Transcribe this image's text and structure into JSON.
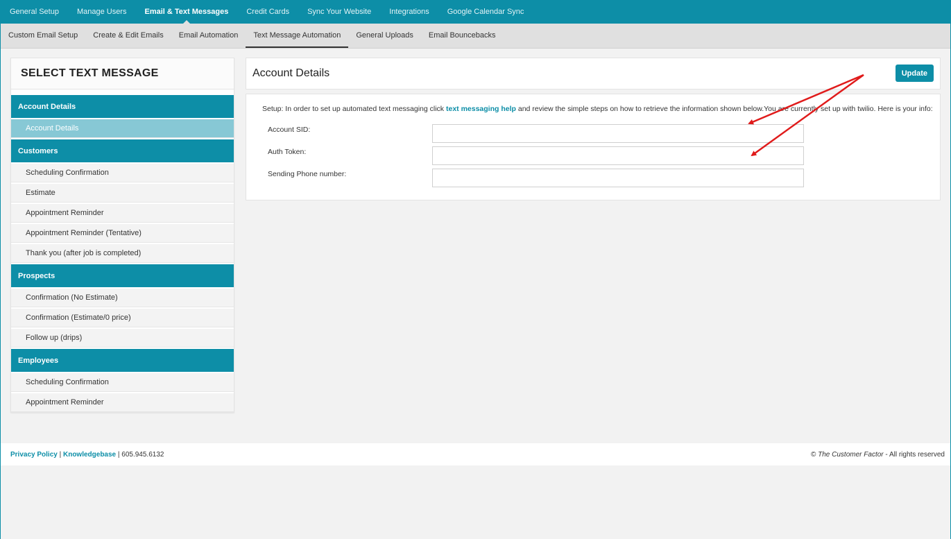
{
  "top_nav": [
    {
      "label": "General Setup"
    },
    {
      "label": "Manage Users"
    },
    {
      "label": "Email & Text Messages",
      "active": true
    },
    {
      "label": "Credit Cards"
    },
    {
      "label": "Sync Your Website"
    },
    {
      "label": "Integrations"
    },
    {
      "label": "Google Calendar Sync"
    }
  ],
  "sub_nav": [
    {
      "label": "Custom Email Setup"
    },
    {
      "label": "Create & Edit Emails"
    },
    {
      "label": "Email Automation"
    },
    {
      "label": "Text Message Automation",
      "active": true
    },
    {
      "label": "General Uploads"
    },
    {
      "label": "Email Bouncebacks"
    }
  ],
  "sidebar": {
    "title": "SELECT TEXT MESSAGE",
    "groups": [
      {
        "label": "Account Details",
        "items": [
          "Account Details"
        ]
      },
      {
        "label": "Customers",
        "items": [
          "Scheduling Confirmation",
          "Estimate",
          "Appointment Reminder",
          "Appointment Reminder (Tentative)",
          "Thank you (after job is completed)"
        ]
      },
      {
        "label": "Prospects",
        "items": [
          "Confirmation (No Estimate)",
          "Confirmation (Estimate/0 price)",
          "Follow up (drips)"
        ]
      },
      {
        "label": "Employees",
        "items": [
          "Scheduling Confirmation",
          "Appointment Reminder"
        ]
      }
    ],
    "selected_item": "Account Details"
  },
  "panel": {
    "title": "Account Details",
    "update_label": "Update",
    "intro_before": "Setup: In order to set up automated text messaging click ",
    "intro_link": "text messaging help",
    "intro_after": " and review the simple steps on how to retrieve the information shown below.You are currently set up with twilio. Here is your info:",
    "fields": [
      {
        "label": "Account SID:",
        "value": ""
      },
      {
        "label": "Auth Token:",
        "value": ""
      },
      {
        "label": "Sending Phone number:",
        "value": ""
      }
    ]
  },
  "footer": {
    "privacy": "Privacy Policy",
    "sep": " | ",
    "kb": "Knowledgebase",
    "phone": " | 605.945.6132",
    "copy_symbol": "© ",
    "company": "The Customer Factor",
    "rights": " - All rights reserved"
  },
  "colors": {
    "brand": "#0d8ea7",
    "arrow": "#e01b1b",
    "selected": "#87c8d5"
  }
}
